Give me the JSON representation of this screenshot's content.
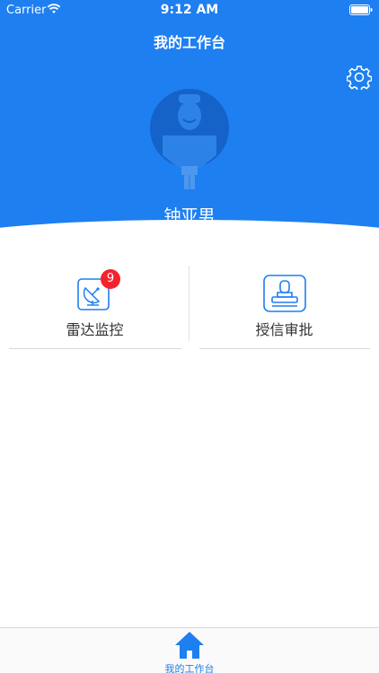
{
  "status_bar": {
    "carrier": "Carrier",
    "time": "9:12 AM"
  },
  "nav": {
    "title": "我的工作台"
  },
  "profile": {
    "name": "钟亚男"
  },
  "workspace": {
    "items": [
      {
        "label": "雷达监控",
        "icon": "radar-icon",
        "badge": "9"
      },
      {
        "label": "授信审批",
        "icon": "stamp-icon"
      }
    ]
  },
  "tab_bar": {
    "items": [
      {
        "label": "我的工作台",
        "icon": "home-icon"
      }
    ]
  },
  "colors": {
    "primary": "#1e7ff0",
    "badge": "#f5222d",
    "text": "#333333"
  }
}
